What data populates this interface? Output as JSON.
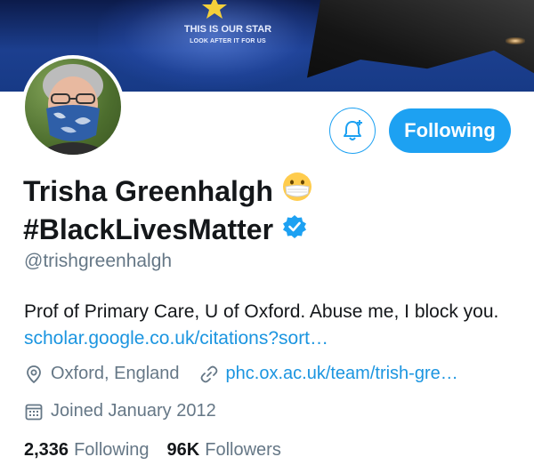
{
  "banner": {
    "text_line1": "THIS IS OUR STAR",
    "text_line2": "LOOK AFTER IT FOR US"
  },
  "profile": {
    "name_line1": "Trisha Greenhalgh",
    "name_line2": "#BlackLivesMatter",
    "handle": "@trishgreenhalgh",
    "bio_text": "Prof of Primary Care, U of Oxford. Abuse me, I block you.",
    "bio_link": "scholar.google.co.uk/citations?sort…",
    "location": "Oxford, England",
    "website": "phc.ox.ac.uk/team/trish-gre…",
    "joined": "Joined January 2012"
  },
  "actions": {
    "follow_label": "Following"
  },
  "stats": {
    "following_count": "2,336",
    "following_label": "Following",
    "followers_count": "96K",
    "followers_label": "Followers"
  },
  "icons": {
    "notify": "bell-plus-icon",
    "location": "location-pin-icon",
    "link": "link-icon",
    "calendar": "calendar-icon",
    "verified": "verified-badge-icon",
    "emoji": "face-with-medical-mask-emoji"
  },
  "colors": {
    "accent": "#1da1f2",
    "link": "#1b95e0",
    "secondary_text": "#657786",
    "primary_text": "#14171a"
  }
}
